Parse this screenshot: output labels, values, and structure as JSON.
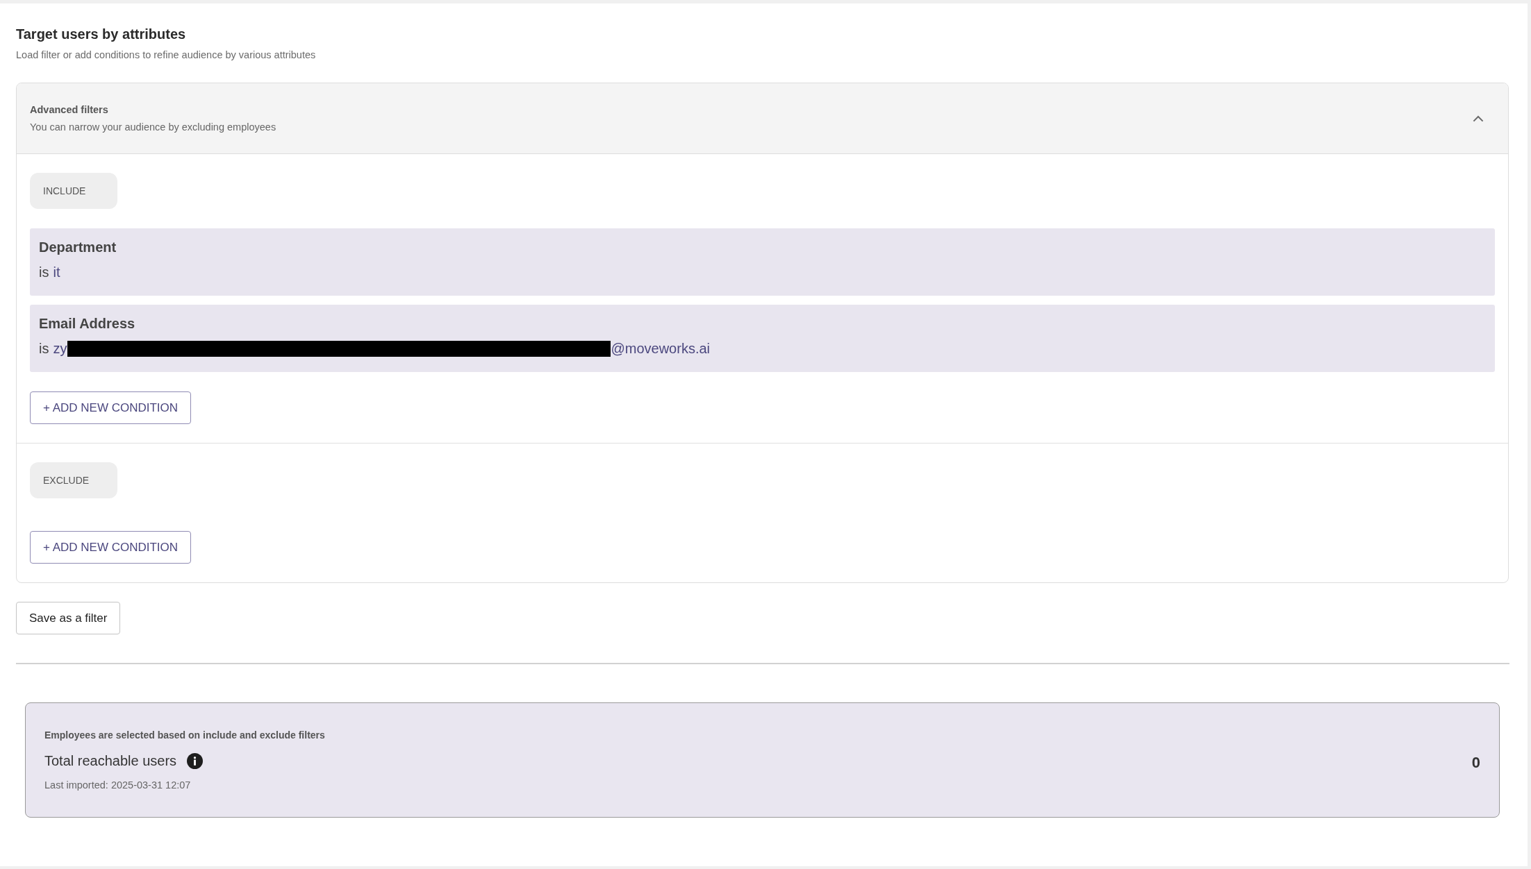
{
  "section": {
    "title": "Target users by attributes",
    "subtitle": "Load filter or add conditions to refine audience by various attributes"
  },
  "advanced_filters": {
    "title": "Advanced filters",
    "subtitle": "You can narrow your audience by excluding employees",
    "expanded": true,
    "groups": [
      {
        "label": "INCLUDE",
        "conditions": [
          {
            "field": "Department",
            "operator": "is",
            "value": "it"
          },
          {
            "field": "Email Address",
            "operator": "is",
            "value": "zy",
            "redacted": true,
            "value_after_redaction": "@moveworks.ai"
          }
        ],
        "add_button": "+ ADD NEW CONDITION"
      },
      {
        "label": "EXCLUDE",
        "add_button": "+ ADD NEW CONDITION"
      }
    ]
  },
  "save_button": "Save as a filter",
  "summary": {
    "note": "Employees are selected based on include and exclude filters",
    "label": "Total reachable users",
    "imported": "Last imported: 2025-03-31 12:07",
    "count": "0"
  }
}
